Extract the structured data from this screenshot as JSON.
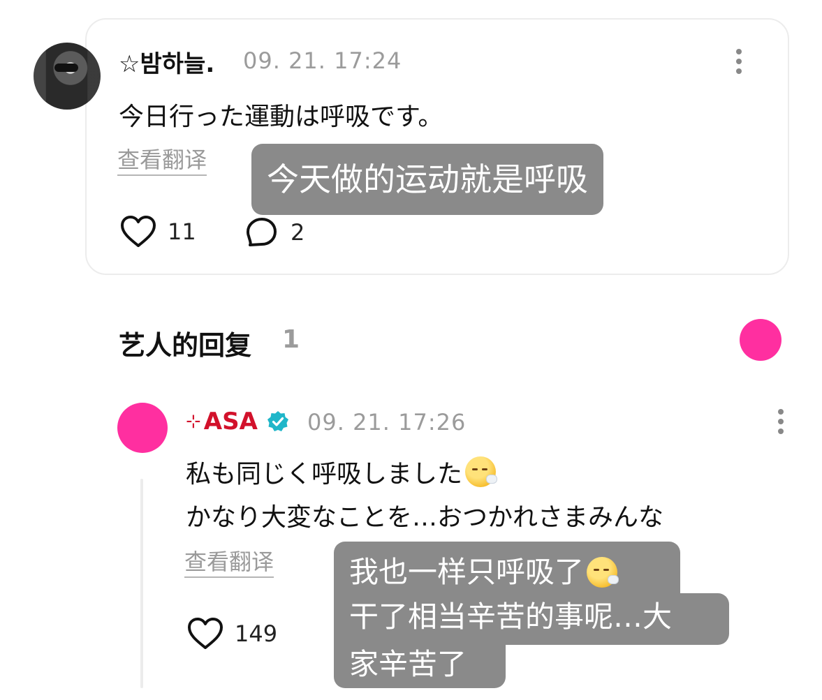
{
  "post": {
    "username": "☆밤하늘.",
    "time": "09. 21. 17:24",
    "text": "今日行った運動は呼吸です。",
    "translate_label": "查看翻译",
    "translation_overlay": "今天做的运动就是呼吸",
    "likes": "11",
    "comments": "2"
  },
  "section": {
    "title": "艺人的回复",
    "count": "1"
  },
  "reply": {
    "sparkle": "⊹",
    "artist": "ASA",
    "time": "09. 21. 17:26",
    "line1": "私も同じく呼吸しました",
    "line2": "かなり大変なことを…おつかれさまみんな",
    "translate_label": "查看翻译",
    "translation_overlay": {
      "line1": "我也一样只呼吸了",
      "line2": "干了相当辛苦的事呢…大",
      "line3": "家辛苦了"
    },
    "likes": "149"
  },
  "icons": {
    "like": "heart-outline-icon",
    "comment": "speech-bubble-icon",
    "more": "vertical-ellipsis-icon",
    "verified": "verified-badge-icon",
    "emoji": "exhaling-face-emoji"
  },
  "colors": {
    "artist_name": "#d2112b",
    "accent_pink": "#ff2fa0",
    "verified": "#1fb6c9",
    "overlay_bg": "#8a8a8a",
    "muted_text": "#9b9b9b"
  }
}
